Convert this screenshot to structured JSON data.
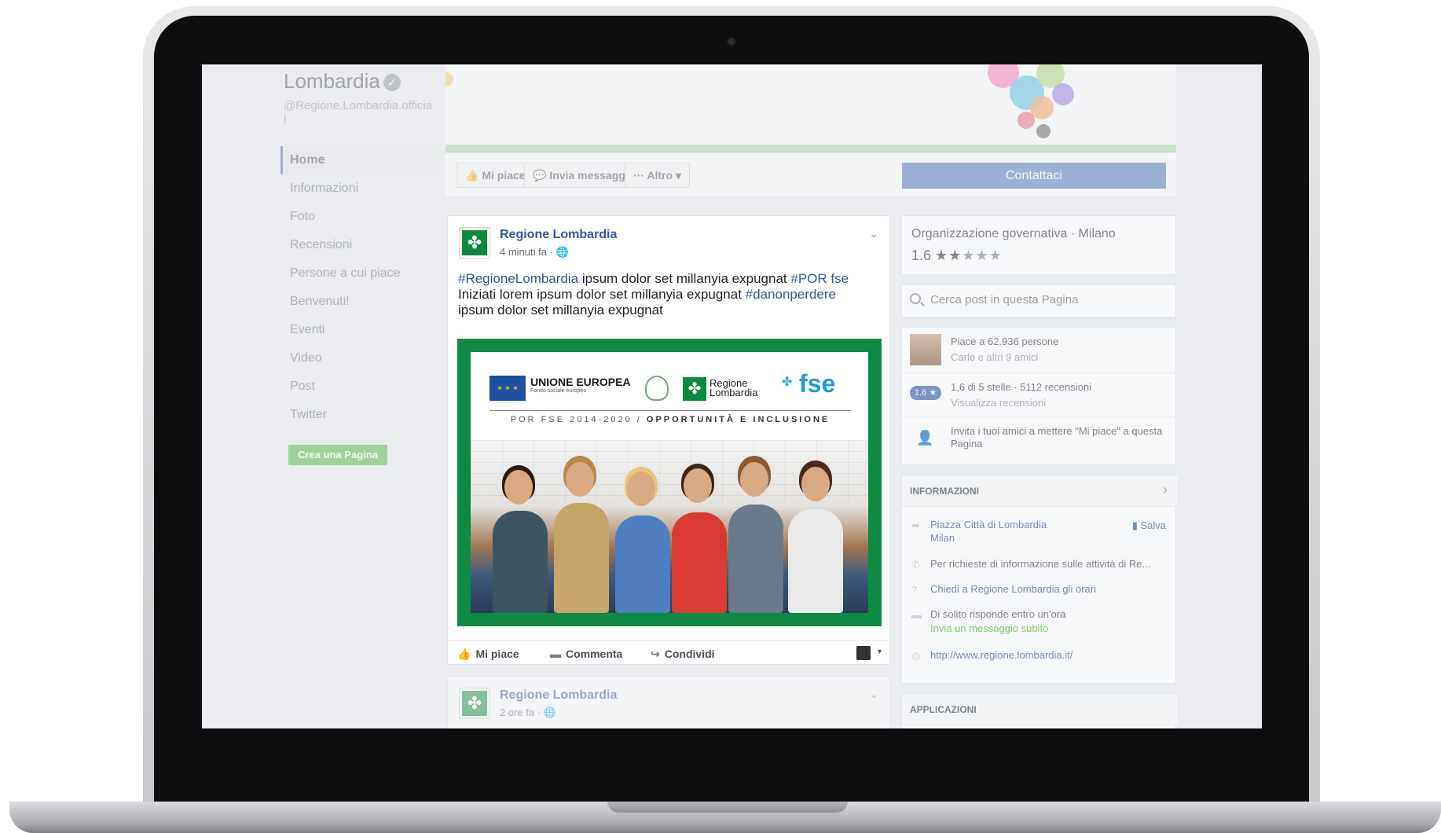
{
  "page": {
    "name": "Lombardia",
    "handle": "@Regione.Lombardia.official"
  },
  "nav": {
    "items": [
      "Home",
      "Informazioni",
      "Foto",
      "Recensioni",
      "Persone a cui piace",
      "Benvenuti!",
      "Eventi",
      "Video",
      "Post",
      "Twitter"
    ],
    "create_page": "Crea una Pagina"
  },
  "actions": {
    "like": "Mi piace",
    "message": "Invia messaggio",
    "more": "··· Altro",
    "contact": "Contattaci"
  },
  "post": {
    "author": "Regione Lombardia",
    "time": "4 minuti fa · ",
    "text": {
      "tag1": "#RegioneLombardia",
      "part1": " ipsum dolor set millanyia expugnat ",
      "tag2": "#POR fse",
      "part2": "Iniziati lorem ipsum dolor set millanyia expugnat ",
      "tag3": "#danonperdere",
      "part3": "ipsum dolor set millanyia expugnat"
    },
    "creative": {
      "eu_title": "UNIONE EUROPEA",
      "eu_subtitle": "Fondo sociale europeo",
      "rl_line1": "Regione",
      "rl_line2": "Lombardia",
      "fse": "fse",
      "tagline_a": "POR FSE 2014-2020 / ",
      "tagline_b": "OPPORTUNITÀ E INCLUSIONE"
    },
    "actions": {
      "like": "Mi piace",
      "comment": "Commenta",
      "share": "Condividi"
    }
  },
  "post2": {
    "author": "Regione Lombardia",
    "time": "2 ore fa · "
  },
  "sidebar": {
    "org_type": "Organizzazione governativa · Milano",
    "rating_value": "1.6",
    "rating_stars": 1.6,
    "search_placeholder": "Cerca post in questa Pagina",
    "likes": "Piace a 62.936 persone",
    "likes_friends": "Carlo e altri 9 amici",
    "rating_pill": "1.6 ★",
    "reviews": "1,6 di 5 stelle · 5112 recensioni",
    "reviews_link": "Visualizza recensioni",
    "invite": "Invita i tuoi amici a mettere \"Mi piace\" a questa Pagina",
    "info_title": "INFORMAZIONI",
    "address_line1": "Piazza Città di Lombardia",
    "address_line2": "Milan",
    "save": "Salva",
    "phone_text": "Per richieste di informazione sulle attività di Re...",
    "hours_link": "Chiedi a Regione Lombardia gli orari",
    "responds": "Di solito risponde entro un'ora",
    "message_now": "Invia un messaggio subito",
    "website": "http://www.regione.lombardia.it/",
    "apps_title": "APPLICAZIONI"
  },
  "colors": {
    "fb_blue": "#4267b2",
    "link": "#365899",
    "green": "#0f8a44",
    "create_green": "#42b72a"
  }
}
